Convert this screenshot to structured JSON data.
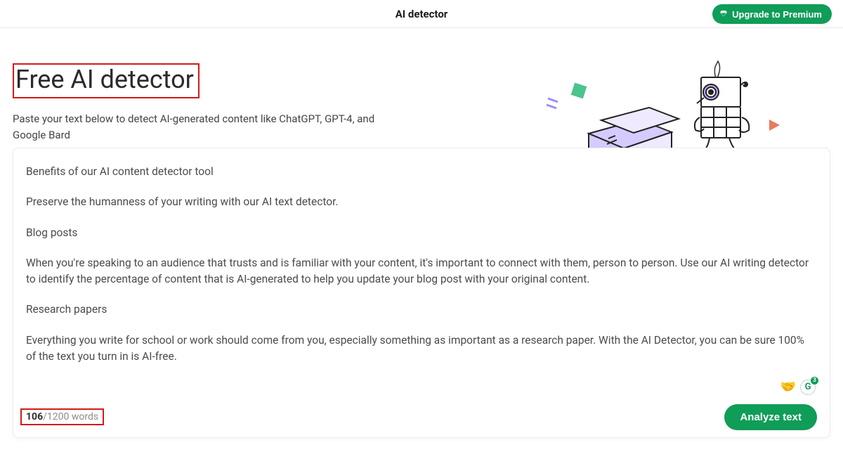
{
  "header": {
    "title": "AI detector",
    "upgrade_label": "Upgrade to Premium"
  },
  "hero": {
    "title": "Free AI detector",
    "subtitle": "Paste your text below to detect AI-generated content like ChatGPT, GPT-4, and Google Bard"
  },
  "editor": {
    "paragraphs": [
      "Benefits of our AI content detector tool",
      "Preserve the humanness of your writing with our AI text detector.",
      "Blog posts",
      "When you're speaking to an audience that trusts and is familiar with your content, it's important to connect with them, person to person. Use our AI writing detector to identify the percentage of content that is AI-generated to help you update your blog post with your original content.",
      "Research papers",
      "Everything you write for school or work should come from you, especially something as important as a research paper. With the AI Detector, you can be sure 100% of the text you turn in is AI-free."
    ]
  },
  "footer": {
    "word_current": "106",
    "word_sep": "/",
    "word_max": "1200",
    "word_unit": " words",
    "analyze_label": "Analyze text"
  },
  "badges": {
    "grammarly_count": "3"
  }
}
